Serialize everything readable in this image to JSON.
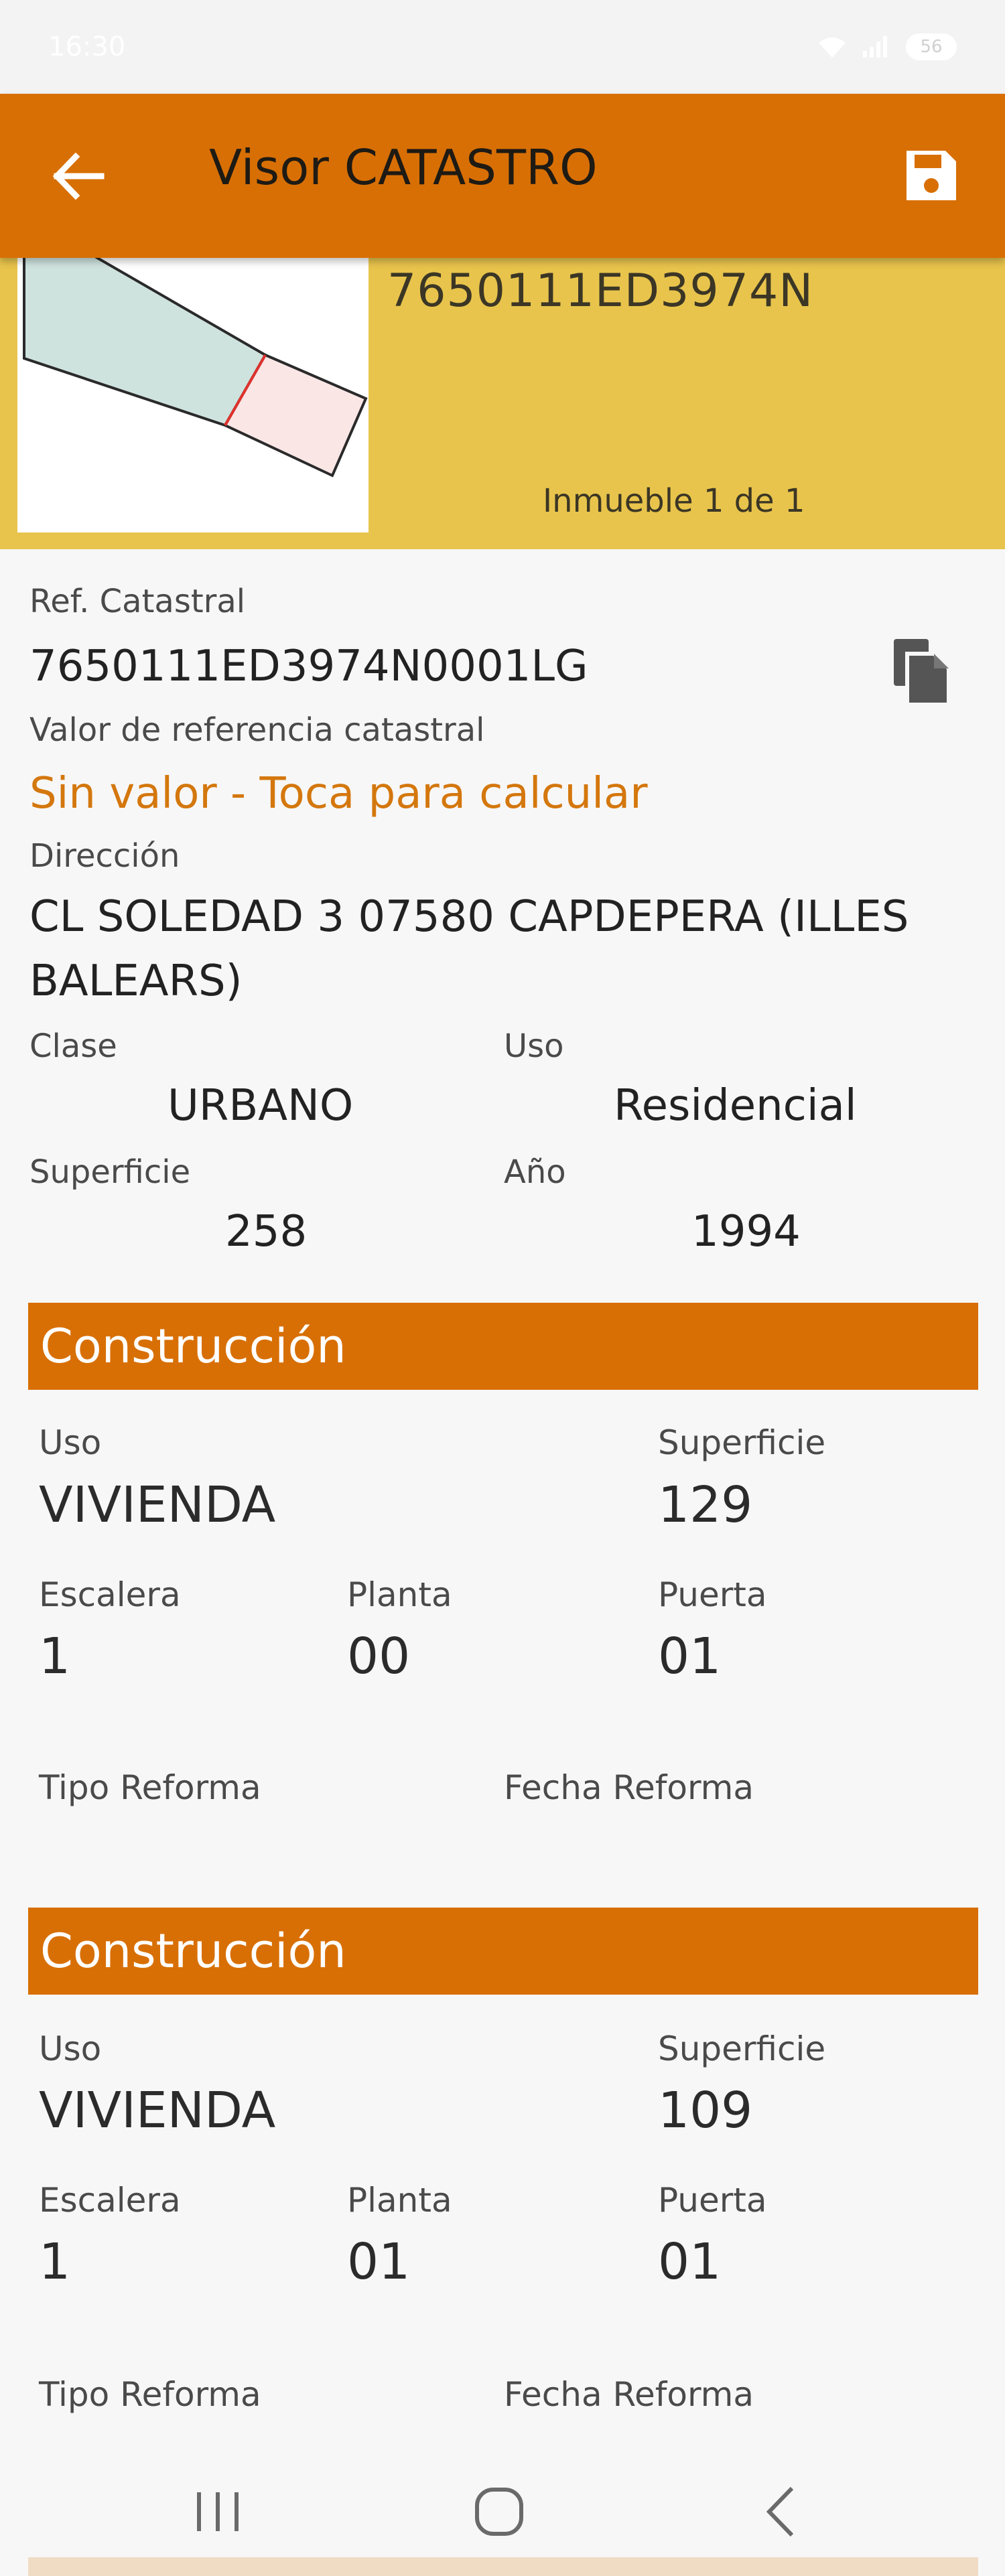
{
  "status_bar": {
    "time": "16:30",
    "battery": "56"
  },
  "app_bar": {
    "title": "Visor CATASTRO",
    "back_icon": "arrow-left-icon",
    "save_icon": "floppy-disk-icon",
    "color": "#d86f04"
  },
  "header": {
    "parcel_ref": "7650111ED3974N",
    "inmueble_count": "Inmueble 1 de 1",
    "color": "#e8c44c"
  },
  "details": {
    "ref_label": "Ref. Catastral",
    "ref_value": "7650111ED3974N0001LG",
    "valor_label": "Valor de referencia catastral",
    "valor_link": "Sin valor - Toca para calcular",
    "direccion_label": "Dirección",
    "direccion_line1": "CL SOLEDAD 3 07580 CAPDEPERA (ILLES",
    "direccion_line2": "BALEARS)",
    "clase_label": "Clase",
    "clase_value": "URBANO",
    "uso_label": "Uso",
    "uso_value": "Residencial",
    "superficie_label": "Superficie",
    "superficie_value": "258",
    "anio_label": "Año",
    "anio_value": "1994"
  },
  "construcciones": [
    {
      "title": "Construcción",
      "uso_label": "Uso",
      "uso_value": "VIVIENDA",
      "superficie_label": "Superficie",
      "superficie_value": "129",
      "escalera_label": "Escalera",
      "escalera_value": "1",
      "planta_label": "Planta",
      "planta_value": "00",
      "puerta_label": "Puerta",
      "puerta_value": "01",
      "tipo_reforma_label": "Tipo Reforma",
      "fecha_reforma_label": "Fecha Reforma"
    },
    {
      "title": "Construcción",
      "uso_label": "Uso",
      "uso_value": "VIVIENDA",
      "superficie_label": "Superficie",
      "superficie_value": "109",
      "escalera_label": "Escalera",
      "escalera_value": "1",
      "planta_label": "Planta",
      "planta_value": "01",
      "puerta_label": "Puerta",
      "puerta_value": "01",
      "tipo_reforma_label": "Tipo Reforma",
      "fecha_reforma_label": "Fecha Reforma"
    }
  ],
  "nav_bar": {
    "recents_icon": "recents-icon",
    "home_icon": "home-icon",
    "back_icon": "back-chevron-icon"
  }
}
